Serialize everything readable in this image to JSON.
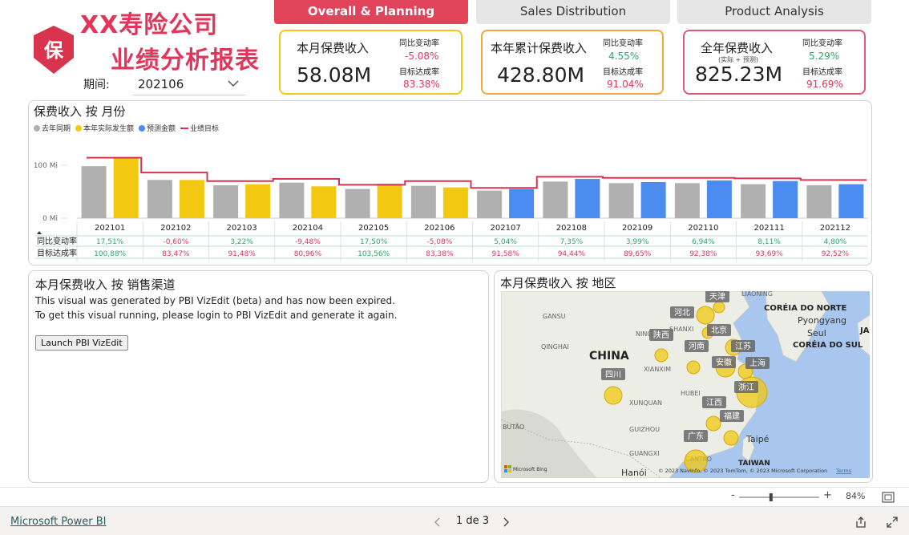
{
  "header": {
    "logo_char": "保",
    "title_line1": "XX寿险公司",
    "title_line2": "业绩分析报表",
    "period_label": "期间:",
    "period_value": "202106"
  },
  "tabs": [
    {
      "label": "Overall & Planning",
      "active": true
    },
    {
      "label": "Sales Distribution",
      "active": false
    },
    {
      "label": "Product Analysis",
      "active": false
    }
  ],
  "kpis": [
    {
      "label": "本月保费收入",
      "sublabel": "",
      "value": "58.08M",
      "yoy_label": "同比变动率",
      "yoy": "-5.08%",
      "yoy_color": "#e1365b",
      "target_label": "目标达成率",
      "target": "83.38%",
      "border": "#f2c811"
    },
    {
      "label": "本年累计保费收入",
      "sublabel": "",
      "value": "428.80M",
      "yoy_label": "同比变动率",
      "yoy": "4.55%",
      "yoy_color": "#2aa86b",
      "target_label": "目标达成率",
      "target": "91.04%",
      "border": "#f4a73b"
    },
    {
      "label": "全年保费收入",
      "sublabel": "(实际 + 预测)",
      "value": "825.23M",
      "yoy_label": "同比变动率",
      "yoy": "5.29%",
      "yoy_color": "#2aa86b",
      "target_label": "目标达成率",
      "target": "91.69%",
      "border": "#e05a77"
    }
  ],
  "monthly_panel": {
    "title": "保费收入 按 月份",
    "legend": [
      {
        "label": "去年同期",
        "color": "#b0b0b0",
        "kind": "dot"
      },
      {
        "label": "本年实际发生额",
        "color": "#f2c811",
        "kind": "dot"
      },
      {
        "label": "预测金额",
        "color": "#4a8cf0",
        "kind": "dot"
      },
      {
        "label": "业绩目标",
        "color": "#d9344e",
        "kind": "line"
      }
    ],
    "row_labels": [
      "同比变动率",
      "目标达成率"
    ]
  },
  "chart_data": {
    "type": "bar",
    "categories": [
      "202101",
      "202102",
      "202103",
      "202104",
      "202105",
      "202106",
      "202107",
      "202108",
      "202109",
      "202110",
      "202111",
      "202112"
    ],
    "ylim": [
      0,
      130
    ],
    "yticks": [
      {
        "value": 0,
        "label": "0 Mi"
      },
      {
        "value": 100,
        "label": "100 Mi"
      }
    ],
    "series": [
      {
        "name": "去年同期",
        "color": "#b0b0b0",
        "values": [
          98,
          72,
          62,
          67,
          55,
          61,
          52,
          69,
          66,
          66,
          64,
          62
        ]
      },
      {
        "name": "本年实际发生额",
        "color": "#f2c811",
        "values": [
          115,
          72,
          64,
          60,
          65,
          58,
          null,
          null,
          null,
          null,
          null,
          null
        ]
      },
      {
        "name": "预测金额",
        "color": "#4a8cf0",
        "values": [
          null,
          null,
          null,
          null,
          null,
          null,
          55,
          74,
          68,
          71,
          70,
          64
        ]
      },
      {
        "name": "业绩目标",
        "color": "#d9344e",
        "kind": "step",
        "values": [
          114,
          86,
          70,
          74,
          63,
          70,
          57,
          78,
          76,
          76,
          75,
          72
        ]
      }
    ],
    "table": {
      "同比变动率": [
        "17,51%",
        "-0,60%",
        "3,22%",
        "-9,48%",
        "17,50%",
        "-5,08%",
        "5,04%",
        "7,35%",
        "3,99%",
        "6,94%",
        "8,11%",
        "4,80%"
      ],
      "目标达成率": [
        "100,88%",
        "83,47%",
        "91,48%",
        "80,96%",
        "103,56%",
        "83,38%",
        "91,58%",
        "94,44%",
        "89,65%",
        "92,38%",
        "93,69%",
        "92,52%"
      ]
    }
  },
  "channel_panel": {
    "title": "本月保费收入 按 销售渠道",
    "message_line1": "This visual was generated by PBI VizEdit (beta) and has now been expired.",
    "message_line2": "To get this visual running, please login to PBI VizEdit and generate it again.",
    "button_label": "Launch PBI VizEdit"
  },
  "region_panel": {
    "title": "本月保费收入 按 地区",
    "map_labels": [
      {
        "text": "CHINA",
        "kind": "country"
      },
      {
        "text": "CORÉIA DO NORTE",
        "kind": "country"
      },
      {
        "text": "Pyongyang",
        "kind": "city"
      },
      {
        "text": "Seul",
        "kind": "city"
      },
      {
        "text": "CORÉIA DO SUL",
        "kind": "country"
      },
      {
        "text": "JA",
        "kind": "country"
      },
      {
        "text": "TAIWAN",
        "kind": "country"
      },
      {
        "text": "Taipé",
        "kind": "city"
      },
      {
        "text": "Hanói",
        "kind": "city"
      },
      {
        "text": "BUTÃO",
        "kind": "minor"
      },
      {
        "text": "LIAONING",
        "kind": "minor"
      },
      {
        "text": "GANSU",
        "kind": "minor"
      },
      {
        "text": "NINGXIA",
        "kind": "minor"
      },
      {
        "text": "QINGHAI",
        "kind": "minor"
      },
      {
        "text": "SHANXI",
        "kind": "minor"
      },
      {
        "text": "HUBEI",
        "kind": "minor"
      },
      {
        "text": "XIANXIM",
        "kind": "minor"
      },
      {
        "text": "XUNQUAN",
        "kind": "minor"
      },
      {
        "text": "GUIZHOU",
        "kind": "minor"
      },
      {
        "text": "GUANGXI",
        "kind": "minor"
      },
      {
        "text": "CANTÃO",
        "kind": "minor"
      }
    ],
    "provinces": [
      {
        "name": "天津",
        "r": 7
      },
      {
        "name": "河北",
        "r": 11
      },
      {
        "name": "北京",
        "r": 7
      },
      {
        "name": "陕西",
        "r": 8
      },
      {
        "name": "河南",
        "r": 8
      },
      {
        "name": "江苏",
        "r": 10
      },
      {
        "name": "安徽",
        "r": 12
      },
      {
        "name": "上海",
        "r": 9
      },
      {
        "name": "四川",
        "r": 11
      },
      {
        "name": "浙江",
        "r": 19
      },
      {
        "name": "江西",
        "r": 9
      },
      {
        "name": "福建",
        "r": 9
      },
      {
        "name": "广东",
        "r": 14
      }
    ],
    "attribution": "© 2023 NavInfo, © 2023 TomTom, © 2023 Microsoft Corporation",
    "terms": "Terms",
    "bing": "Microsoft Bing"
  },
  "zoom": {
    "minus": "-",
    "plus": "+",
    "value": "84%",
    "level": 0.84
  },
  "footer": {
    "brand": "Microsoft Power BI",
    "page_indicator": "1 de 3"
  },
  "colors": {
    "accent": "#e1435a",
    "title": "#e1365b",
    "positive": "#2aa86b",
    "negative": "#e1365b",
    "bubble": "#f2c811"
  }
}
